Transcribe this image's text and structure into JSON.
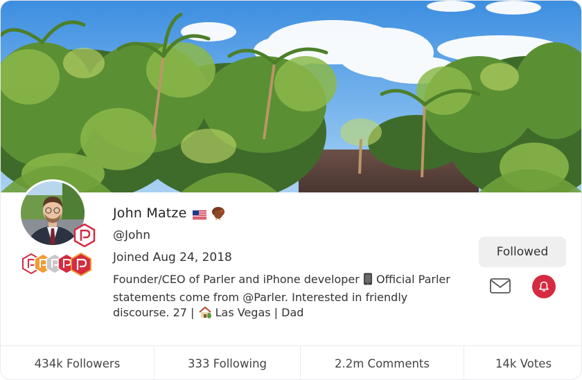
{
  "profile": {
    "name": "John Matze",
    "handle": "@John",
    "joined": "Joined Aug 24, 2018",
    "bio_part1": "Founder/CEO of Parler and iPhone developer ",
    "bio_part2": " Official Parler statements come from @Parler. Interested in friendly discourse. 27 | ",
    "bio_part3": " Las Vegas | Dad",
    "name_emojis": [
      "us-flag-icon",
      "turkey-icon"
    ],
    "bio_emojis": [
      "phone-icon",
      "house-icon"
    ]
  },
  "actions": {
    "follow_label": "Followed",
    "message_icon": "mail-icon",
    "notify_icon": "bell-icon"
  },
  "stats": {
    "followers": "434k Followers",
    "following": "333 Following",
    "comments": "2.2m Comments",
    "votes": "14k Votes"
  },
  "badges": {
    "count": 5,
    "primary": "parler-badge-icon"
  },
  "colors": {
    "brand_red": "#d52a3f",
    "badge_orange": "#f29b34",
    "button_gray": "#efefef"
  }
}
